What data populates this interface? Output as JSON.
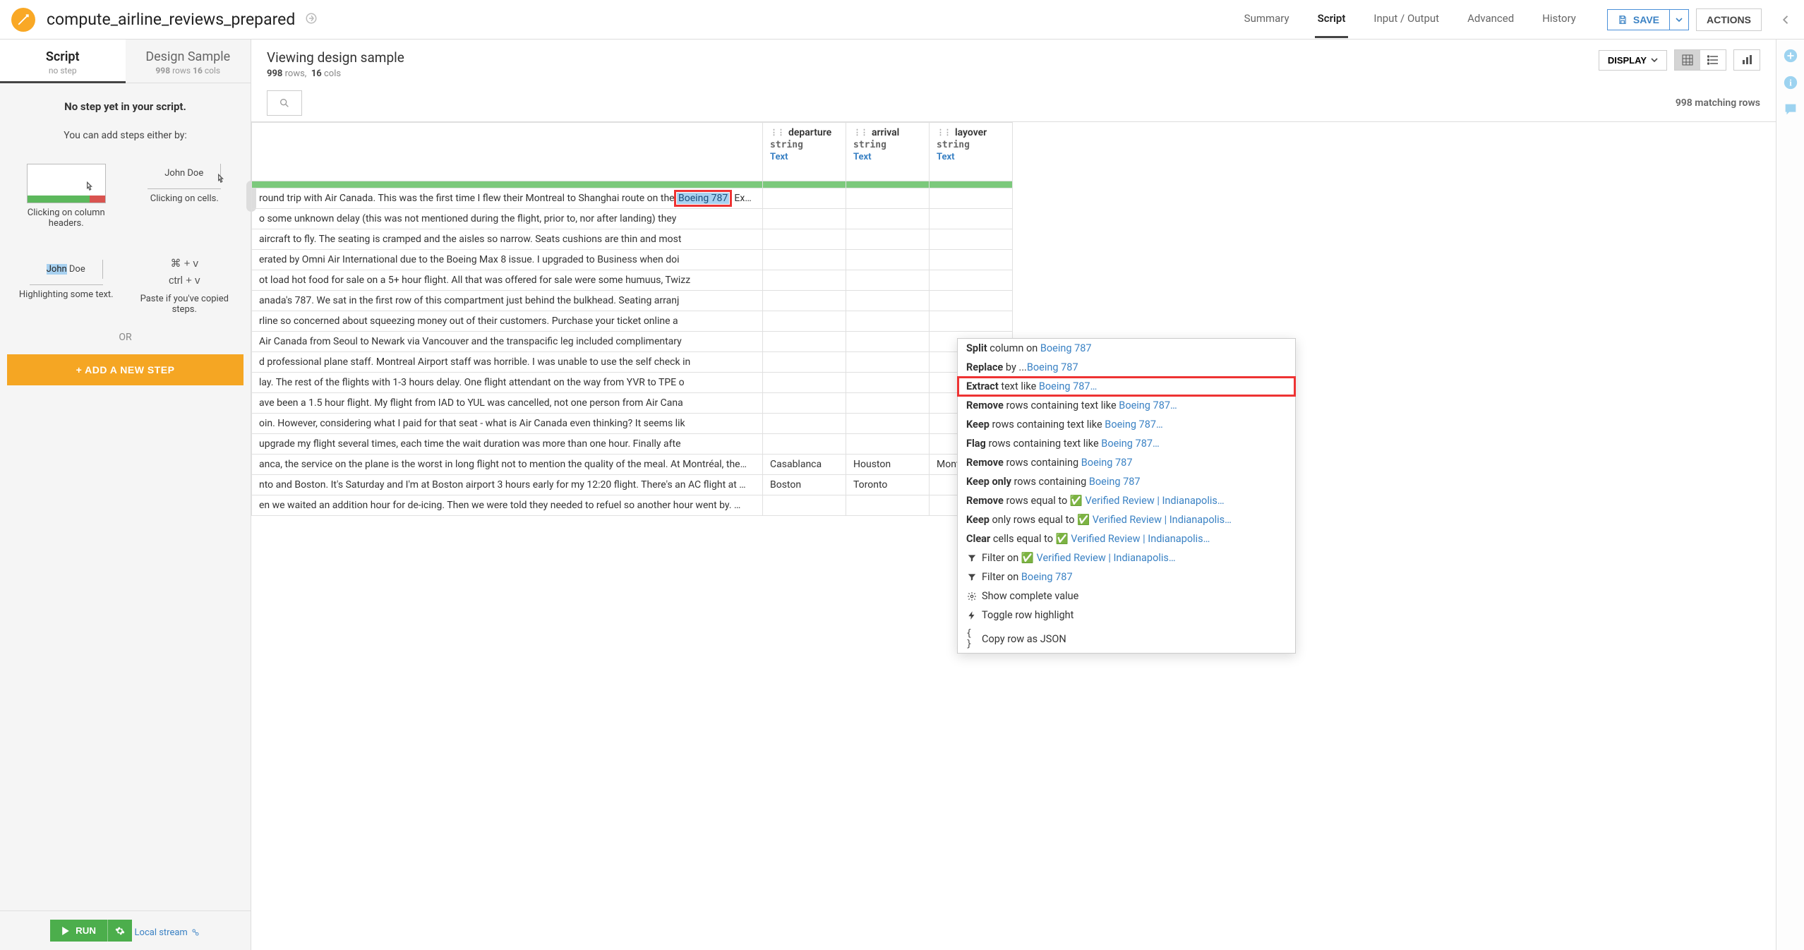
{
  "header": {
    "title": "compute_airline_reviews_prepared",
    "nav": [
      "Summary",
      "Script",
      "Input / Output",
      "Advanced",
      "History"
    ],
    "active_nav": "Script",
    "save_label": "SAVE",
    "actions_label": "ACTIONS"
  },
  "sidebar": {
    "tabs": [
      {
        "title": "Script",
        "sub": "no step"
      },
      {
        "title": "Design Sample",
        "sub_rows": "998",
        "sub_rows_label": "rows",
        "sub_cols": "16",
        "sub_cols_label": "cols"
      }
    ],
    "active_tab": 0,
    "nostep_title": "No step yet in your script.",
    "nostep_sub": "You can add steps either by:",
    "example1_caption": "Clicking on column headers.",
    "example2_name": "John Doe",
    "example2_caption": "Clicking on cells.",
    "example3_first": "John",
    "example3_rest": " Doe",
    "example3_caption": "Highlighting some text.",
    "example4_line1": "⌘  +  v",
    "example4_line2": "ctrl  +  v",
    "example4_caption": "Paste if you've copied steps.",
    "or": "OR",
    "add_step_label": "+ ADD A NEW STEP",
    "run_label": "RUN",
    "local_stream": "Local stream"
  },
  "main": {
    "title": "Viewing design sample",
    "rows": "998",
    "rows_label": "rows,",
    "cols": "16",
    "cols_label": "cols",
    "display_label": "DISPLAY",
    "matching": "998 matching rows",
    "columns": [
      {
        "name": "departure",
        "type": "string",
        "meaning": "Text"
      },
      {
        "name": "arrival",
        "type": "string",
        "meaning": "Text"
      },
      {
        "name": "layover",
        "type": "string",
        "meaning": "Text"
      }
    ],
    "selected_token": "Boeing 787",
    "rows_data": [
      {
        "text_prefix": "round trip with Air Canada. This was the first time I flew their Montreal to Shanghai route on the ",
        "text_suffix": ". Ex…",
        "departure": "",
        "arrival": "",
        "layover": ""
      },
      {
        "text": "o some unknown delay (this was not mentioned during the flight, prior to, nor after landing) they",
        "departure": "",
        "arrival": "",
        "layover": ""
      },
      {
        "text": "aircraft to fly. The seating is cramped and the aisles so narrow. Seats cushions are thin and most",
        "departure": "",
        "arrival": "",
        "layover": ""
      },
      {
        "text": "erated by Omni Air International due to the Boeing Max 8 issue. I upgraded to Business when doi",
        "departure": "",
        "arrival": "",
        "layover": ""
      },
      {
        "text": "ot load hot food for sale on a 5+ hour flight. All that was offered for sale were some humuus, Twizz",
        "departure": "",
        "arrival": "",
        "layover": ""
      },
      {
        "text": "anada's 787. We sat in the first row of this compartment just behind the bulkhead. Seating arranj",
        "departure": "",
        "arrival": "",
        "layover": ""
      },
      {
        "text": "rline so concerned about squeezing money out of their customers. Purchase your ticket online a",
        "departure": "",
        "arrival": "",
        "layover": ""
      },
      {
        "text": "Air Canada from Seoul to Newark via Vancouver and the transpacific leg included complimentary",
        "departure": "",
        "arrival": "",
        "layover": ""
      },
      {
        "text": "d professional plane staff. Montreal Airport staff was horrible. I was unable to use the self check in",
        "departure": "",
        "arrival": "",
        "layover": ""
      },
      {
        "text": "lay. The rest of the flights with 1-3 hours delay. One flight attendant on the way from YVR to TPE o",
        "departure": "",
        "arrival": "",
        "layover": ""
      },
      {
        "text": "ave been a 1.5 hour flight. My flight from IAD to YUL was cancelled, not one person from Air Cana",
        "departure": "",
        "arrival": "",
        "layover": ""
      },
      {
        "text": "oin. However, considering what I paid for that seat - what is Air Canada even thinking? It seems lik",
        "departure": "",
        "arrival": "",
        "layover": ""
      },
      {
        "text": "upgrade my flight several times, each time the wait duration was more than one hour. Finally afte",
        "departure": "",
        "arrival": "",
        "layover": ""
      },
      {
        "text": "anca, the service on the plane is the worst in long flight not to mention the quality of the meal. At Montréal, the…",
        "departure": "Casablanca",
        "arrival": "Houston",
        "layover": "Montreal"
      },
      {
        "text": "nto and Boston. It's Saturday and I'm at Boston airport 3 hours early for my 12:20 flight. There's an AC flight at …",
        "departure": "Boston",
        "arrival": "Toronto",
        "layover": ""
      },
      {
        "text": "en we waited an addition hour for de-icing. Then we were told they needed to refuel so another hour went by. …",
        "departure": "",
        "arrival": "",
        "layover": ""
      }
    ]
  },
  "context_menu": {
    "token": "Boeing 787",
    "verified": "✅ Verified Review | Indianapolis…",
    "items": [
      {
        "bold": "Split",
        "rest": " column on ",
        "link": "Boeing 787"
      },
      {
        "bold": "Replace ",
        "link": "Boeing 787",
        "rest": " by ..."
      },
      {
        "bold": "Extract",
        "rest": " text like ",
        "link": "Boeing 787…",
        "highlighted": true
      },
      {
        "bold": "Remove",
        "rest": " rows containing text like ",
        "link": "Boeing 787…"
      },
      {
        "bold": "Keep",
        "rest": " rows containing text like ",
        "link": "Boeing 787…"
      },
      {
        "bold": "Flag",
        "rest": " rows containing text like ",
        "link": "Boeing 787…"
      },
      {
        "bold": "Remove",
        "rest": " rows containing ",
        "link": "Boeing 787"
      },
      {
        "bold": "Keep only",
        "rest": " rows containing ",
        "link": "Boeing 787"
      },
      {
        "bold": "Remove",
        "rest": " rows equal to ",
        "verified": true
      },
      {
        "bold": "Keep",
        "rest": " only rows equal to ",
        "verified": true
      },
      {
        "bold": "Clear",
        "rest": " cells equal to ",
        "verified": true
      },
      {
        "icon": "filter",
        "rest": " Filter on ",
        "verified": true
      },
      {
        "icon": "filter",
        "rest": " Filter on ",
        "link": "Boeing 787"
      },
      {
        "icon": "gear",
        "rest": " Show complete value"
      },
      {
        "icon": "bolt",
        "rest": " Toggle row highlight"
      },
      {
        "icon": "braces",
        "rest": " Copy row as JSON"
      }
    ]
  }
}
